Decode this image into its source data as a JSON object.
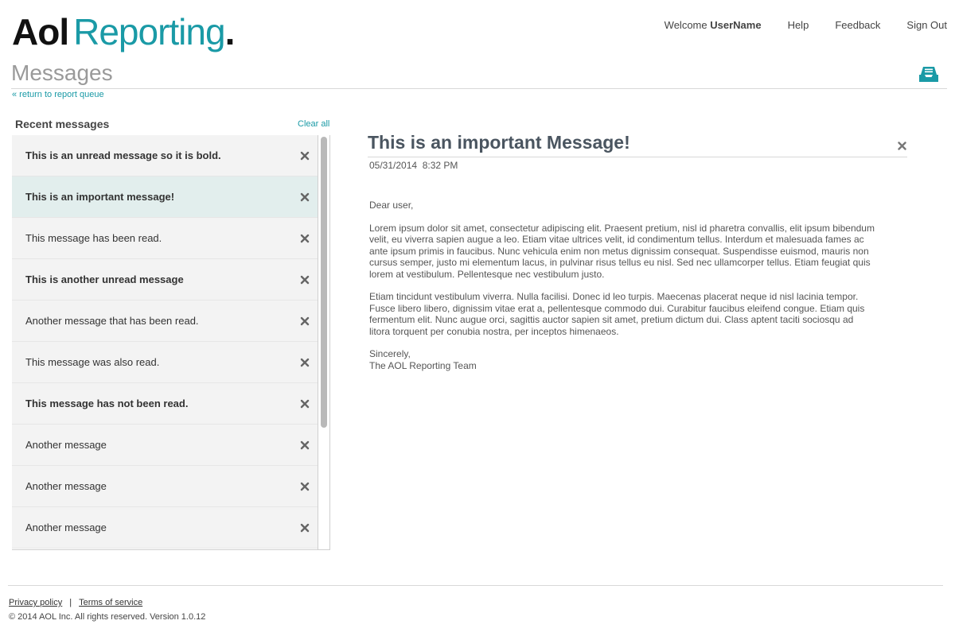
{
  "brand": {
    "part1": "Aol",
    "part2": "Reporting",
    "dot": "."
  },
  "nav": {
    "welcome_prefix": "Welcome ",
    "username": "UserName",
    "help": "Help",
    "feedback": "Feedback",
    "sign_out": "Sign Out"
  },
  "page": {
    "title": "Messages",
    "back_link": "« return to report queue",
    "icon": "inbox-icon"
  },
  "list": {
    "heading": "Recent messages",
    "clear_all": "Clear all",
    "items": [
      {
        "text": "This is an unread message so it is bold.",
        "unread": true,
        "selected": false
      },
      {
        "text": "This is an important message!",
        "unread": true,
        "selected": true
      },
      {
        "text": "This message has been read.",
        "unread": false,
        "selected": false
      },
      {
        "text": "This is another unread message",
        "unread": true,
        "selected": false
      },
      {
        "text": "Another message that has been read.",
        "unread": false,
        "selected": false
      },
      {
        "text": "This message was also read.",
        "unread": false,
        "selected": false
      },
      {
        "text": "This message has not been read.",
        "unread": true,
        "selected": false
      },
      {
        "text": "Another message",
        "unread": false,
        "selected": false
      },
      {
        "text": "Another message",
        "unread": false,
        "selected": false
      },
      {
        "text": "Another message",
        "unread": false,
        "selected": false
      }
    ]
  },
  "message": {
    "title": "This is an important Message!",
    "date": "05/31/2014  8:32 PM",
    "greeting": "Dear user,",
    "para1": "Lorem ipsum dolor sit amet, consectetur adipiscing elit. Praesent pretium, nisl id pharetra convallis, elit ipsum bibendum velit, eu viverra sapien augue a leo. Etiam vitae ultrices velit, id condimentum tellus. Interdum et malesuada fames ac ante ipsum primis in faucibus. Nunc vehicula enim non metus dignissim consequat. Suspendisse euismod, mauris non cursus semper, justo mi elementum lacus, in pulvinar risus tellus eu nisl. Sed nec ullamcorper tellus. Etiam feugiat quis lorem at vestibulum. Pellentesque nec vestibulum justo.",
    "para2": "Etiam tincidunt vestibulum viverra. Nulla facilisi. Donec id leo turpis. Maecenas placerat neque id nisl lacinia tempor. Fusce libero libero, dignissim vitae erat a, pellentesque commodo dui. Curabitur faucibus eleifend congue. Etiam quis fermentum elit. Nunc augue orci, sagittis auctor sapien sit amet, pretium dictum dui. Class aptent taciti sociosqu ad litora torquent per conubia nostra, per inceptos himenaeos.",
    "closing": "Sincerely,",
    "signature": "The AOL Reporting Team"
  },
  "footer": {
    "privacy": "Privacy policy",
    "separator": "|",
    "terms": "Terms of service",
    "copyright": "© 2014 AOL Inc. All rights reserved. Version 1.0.12"
  },
  "colors": {
    "accent": "#1a9aa6",
    "selected_row": "#e2eeed",
    "row": "#f3f3f3"
  }
}
